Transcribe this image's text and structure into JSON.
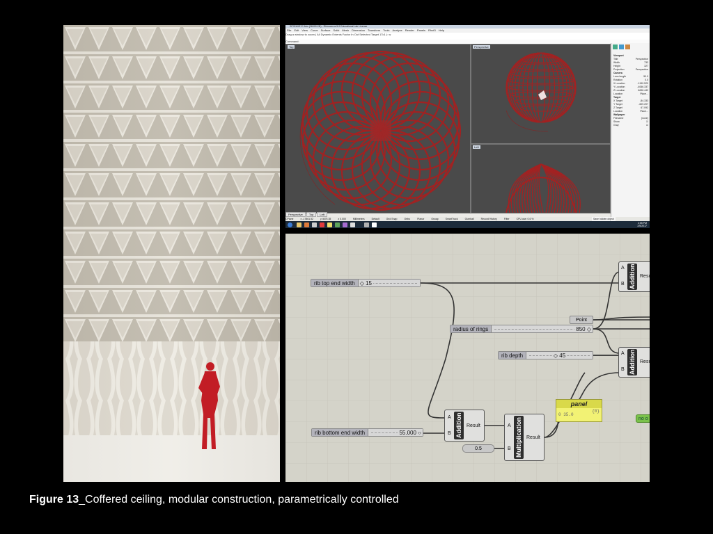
{
  "caption": {
    "bold": "Figure 13",
    "text": "_Coffered ceiling, modular construction, parametrically controlled"
  },
  "rhino": {
    "title": "SPONHIE E.3dm (36000 KB) - Rhinoceros 5.0 Educational Lab License",
    "menu": [
      "File",
      "Edit",
      "View",
      "Curve",
      "Surface",
      "Solid",
      "Mesh",
      "Dimension",
      "Transform",
      "Tools",
      "Analyze",
      "Render",
      "Panels",
      "Rhot3",
      "Help"
    ],
    "command_history": "Drag a window to zoom ( All Dynamic Extents Factor In Out Selected Target 1To1 ): w",
    "command_line": "Command:",
    "viewports": {
      "top": "Top",
      "perspective": "Perspective",
      "left": "Left"
    },
    "viewport_tabs": [
      "Perspective",
      "Top",
      "Left"
    ],
    "properties": [
      [
        "Viewport",
        ""
      ],
      [
        "Title",
        "Perspective"
      ],
      [
        "Width",
        "733"
      ],
      [
        "Height",
        "327"
      ],
      [
        "Projection",
        "Perspective"
      ],
      [
        "Camera",
        ""
      ],
      [
        "Lens length",
        "50.0"
      ],
      [
        "Rotation",
        "0.0"
      ],
      [
        "X Location",
        "-1190.520"
      ],
      [
        "Y Location",
        "-4066.337"
      ],
      [
        "Z Location",
        "6696.442"
      ],
      [
        "Location",
        "Place..."
      ],
      [
        "Target",
        ""
      ],
      [
        "X Target",
        "-84.333"
      ],
      [
        "Y Target",
        "-609.207"
      ],
      [
        "Z Target",
        "67.092"
      ],
      [
        "Location",
        "Place..."
      ],
      [
        "Wallpaper",
        ""
      ],
      [
        "Filename",
        "(none)"
      ],
      [
        "Show",
        "☑"
      ],
      [
        "Gray",
        "☑"
      ]
    ],
    "status": [
      "CPlane",
      "x -17861.52",
      "y 4675.35",
      "z 0.000",
      "Millimeters",
      "Default",
      "Grid Snap",
      "Ortho",
      "Planar",
      "Osnap",
      "SmartTrack",
      "Gumball",
      "Record History",
      "Filter",
      "CPU use: 0.6 %"
    ],
    "clock": {
      "time": "2:55 PM",
      "date": "2/5/2017"
    },
    "save_tip": "Save hidden object"
  },
  "grasshopper": {
    "sliders": {
      "rib_top": {
        "label": "rib top end width",
        "value": "◇ 15"
      },
      "radius": {
        "label": "radius of rings",
        "value": "850 ◇"
      },
      "rib_depth": {
        "label": "rib depth",
        "value": "◇ 45"
      },
      "rib_bottom": {
        "label": "rib bottom end width",
        "value": "55.000 ○"
      }
    },
    "point": "Point",
    "half": "0.5",
    "addition": "Addition",
    "multiplication": "Multiplication",
    "result": "Result",
    "pin_a": "A",
    "pin_b": "B",
    "panel": {
      "title": "panel",
      "index": "{0}",
      "value": "0  35.0"
    },
    "green": "no o"
  }
}
